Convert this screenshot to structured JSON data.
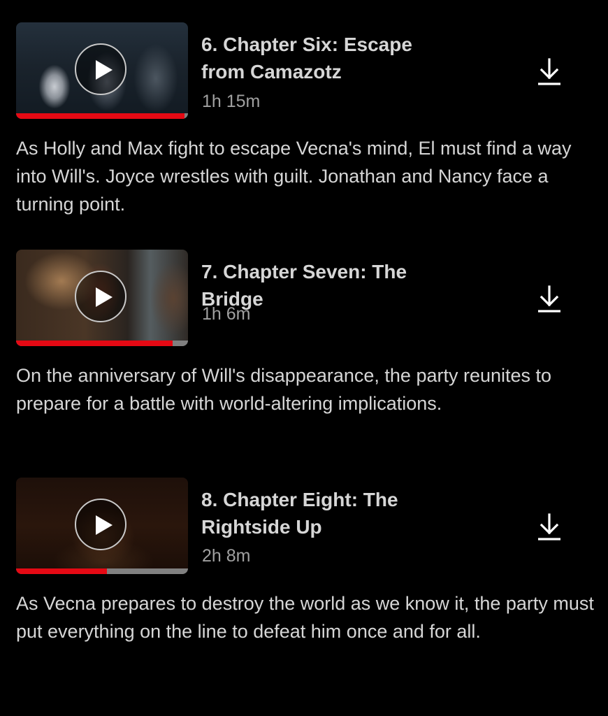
{
  "episodes": [
    {
      "title_line1": "6. Chapter Six: Escape",
      "title_line2": "from Camazotz",
      "duration": "1h 15m",
      "description": "As Holly and Max fight to escape Vecna's mind, El must find a way into Will's. Joyce wrestles with guilt. Jonathan and Nancy face a turning point.",
      "progress": 0.98,
      "icons": {
        "play": "play-icon",
        "download": "download-icon"
      }
    },
    {
      "title_line1": "7. Chapter Seven: The Bridge",
      "title_line2": "",
      "duration": "1h 6m",
      "description": "On the anniversary of Will's disappearance, the party reunites to prepare for a battle with world-altering implications.",
      "progress": 0.91,
      "icons": {
        "play": "play-icon",
        "download": "download-icon"
      }
    },
    {
      "title_line1": "8. Chapter Eight: The",
      "title_line2": "Rightside Up",
      "duration": "2h 8m",
      "description": "As Vecna prepares to destroy the world as we know it, the party must put everything on the line to defeat him once and for all.",
      "progress": 0.53,
      "icons": {
        "play": "play-icon",
        "download": "download-icon"
      }
    }
  ],
  "colors": {
    "background": "#000000",
    "progress_watched": "#e50914",
    "progress_track": "#808080",
    "title_text": "#d6d6d6",
    "duration_text": "#a0a0a0"
  }
}
